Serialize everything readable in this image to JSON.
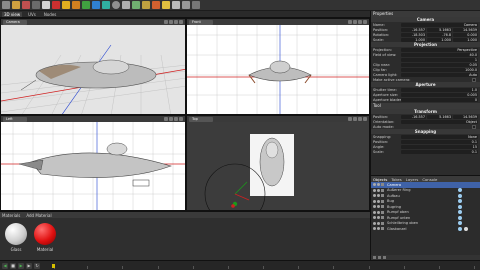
{
  "tabs": [
    {
      "label": "3D view"
    },
    {
      "label": "UVs"
    },
    {
      "label": "Nodes"
    }
  ],
  "viewports": {
    "perspective": {
      "camera": "Camera"
    },
    "front": {
      "camera": "Front"
    },
    "left": {
      "camera": "Left"
    },
    "top": {
      "camera": "Top"
    }
  },
  "materials": {
    "title": "Materials",
    "add_label": "Add Material",
    "items": [
      {
        "name": "Glass",
        "color": "#ececec"
      },
      {
        "name": "Material",
        "color": "#e01010"
      }
    ]
  },
  "properties": {
    "title": "Properties",
    "camera_section": "Camera",
    "name_label": "Name:",
    "name_value": "Camera",
    "position_label": "Position:",
    "position": [
      "-16.557",
      "5.1663",
      "14.5639"
    ],
    "rotation_label": "Rotation:",
    "rotation": [
      "-18.503",
      "-76.8",
      "0.000"
    ],
    "scale_label": "Scale:",
    "scale": [
      "1.000",
      "1.000",
      "1.000"
    ],
    "projection_section": "Projection",
    "rows": [
      {
        "label": "Projection:",
        "value": "Perspective"
      },
      {
        "label": "Field of view:",
        "value": "40.0"
      },
      {
        "label": "",
        "value": "1"
      },
      {
        "label": "Clip near:",
        "value": "0.05"
      },
      {
        "label": "Clip far:",
        "value": "1000.0"
      },
      {
        "label": "Camera light:",
        "value": "Auto"
      },
      {
        "label": "Make active camera:",
        "value": ""
      }
    ],
    "aperture_section": "Aperture",
    "aperture_rows": [
      {
        "label": "Shutter time:",
        "value": "1.0"
      },
      {
        "label": "Aperture size:",
        "value": "0.005"
      },
      {
        "label": "Aperture blades:",
        "value": "0"
      }
    ],
    "tool_title": "Tool",
    "transform_section": "Transform",
    "tool_position_label": "Position:",
    "tool_position": [
      "-16.557",
      "5.1663",
      "14.5639"
    ],
    "orientation_label": "Orientation:",
    "orientation_value": "Object",
    "auto_mode_label": "Auto mode:",
    "snapping_section": "Snapping",
    "snapping_rows": [
      {
        "label": "Snapping:",
        "value": "None"
      },
      {
        "label": "Position:",
        "value": "0.1"
      },
      {
        "label": "Angle:",
        "value": "15"
      },
      {
        "label": "Scale:",
        "value": "0.1"
      }
    ]
  },
  "objects": {
    "tabs": [
      "Objects",
      "Tokes",
      "Layers",
      "Console"
    ],
    "items": [
      {
        "name": "Camera",
        "selected": true
      },
      {
        "name": "Außerer Ring",
        "selected": false
      },
      {
        "name": "Aufbau",
        "selected": false
      },
      {
        "name": "Bug",
        "selected": false
      },
      {
        "name": "Bugring",
        "selected": false
      },
      {
        "name": "Rumpf oben",
        "selected": false
      },
      {
        "name": "Rumpf unten",
        "selected": false
      },
      {
        "name": "Schleilbring oben",
        "selected": false
      },
      {
        "name": "Glaskanzel",
        "selected": false
      }
    ]
  },
  "timeline": {
    "frames": [
      1,
      20,
      40,
      60,
      80,
      100,
      120,
      140,
      160,
      180,
      200,
      220,
      240
    ]
  },
  "colors": {
    "accent": "#3f62a8",
    "grid_x": "#d02020",
    "grid_y": "#2040d0",
    "grid_line": "#bdbdbd",
    "hull": "#c8c8c8"
  }
}
